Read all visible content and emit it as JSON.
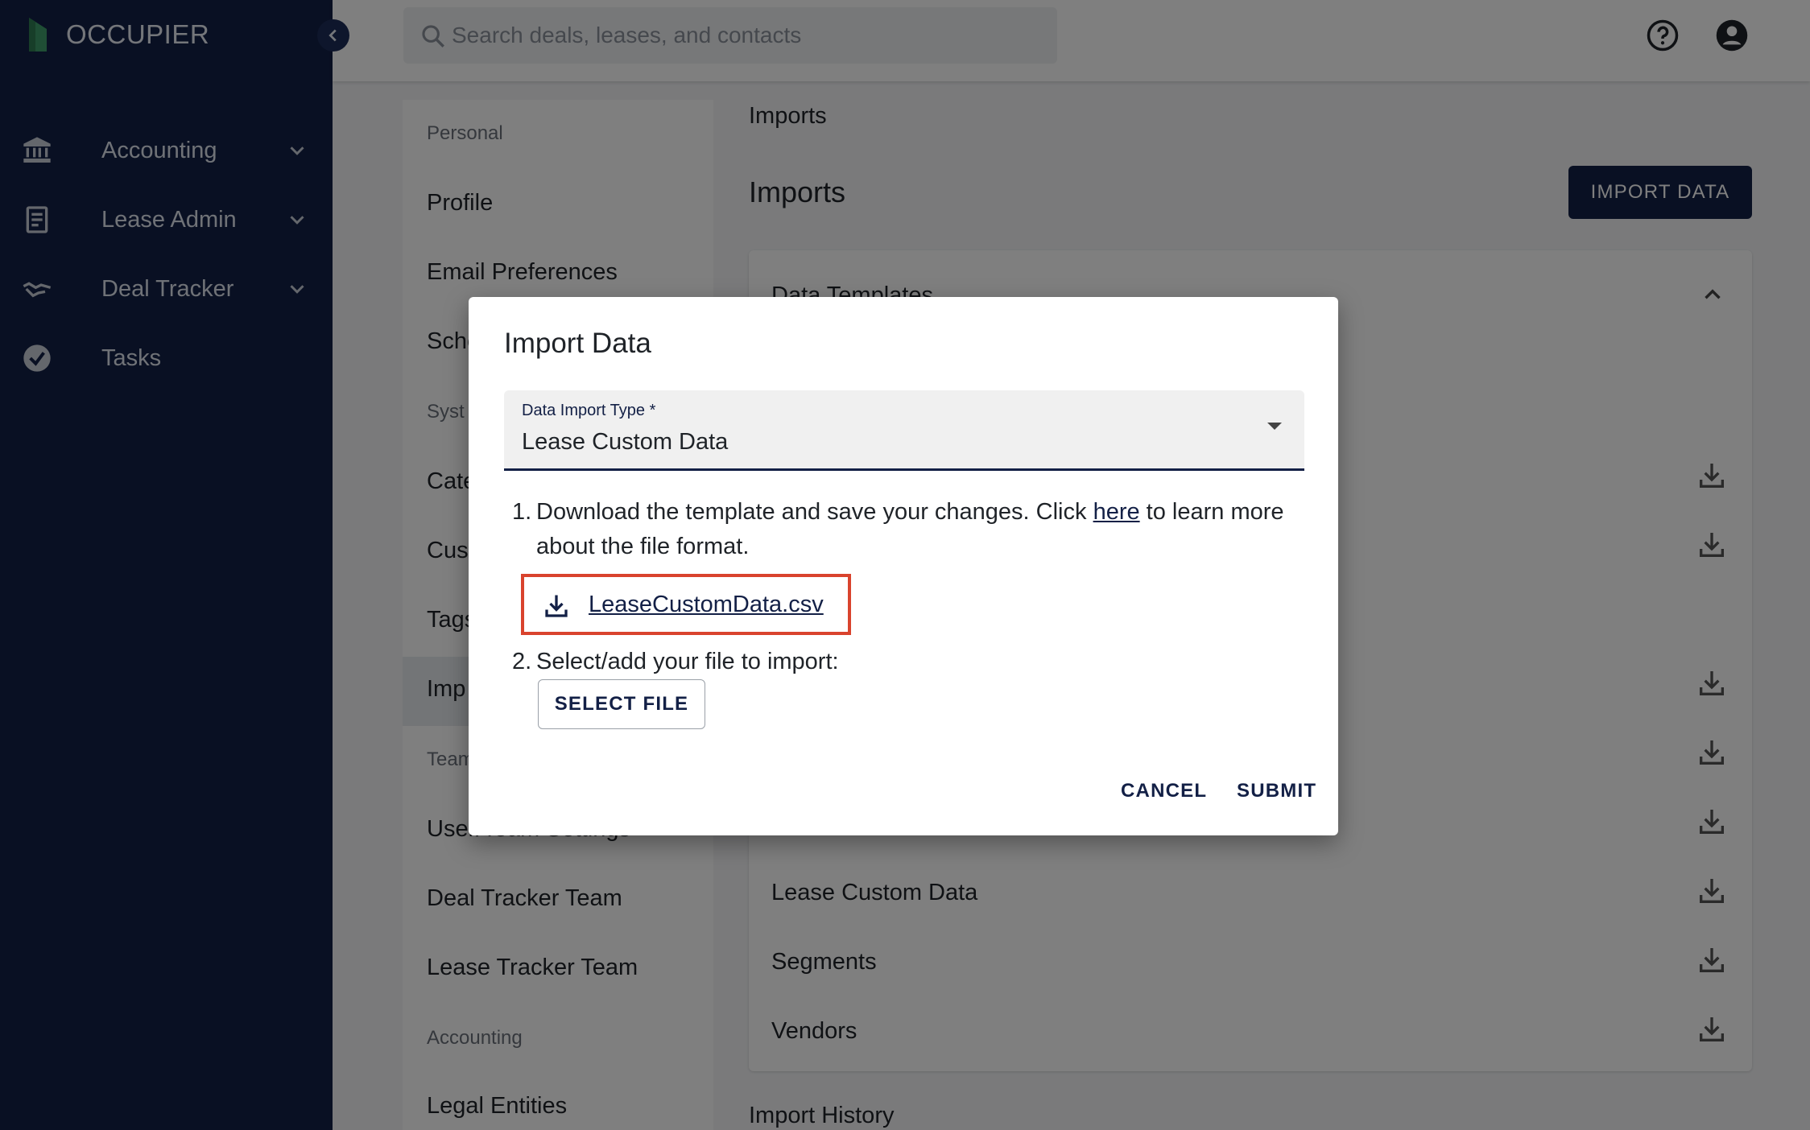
{
  "brand": {
    "name": "OCCUPIER",
    "accent": "#132046",
    "logo_green": "#3f9c6a"
  },
  "nav": {
    "items": [
      {
        "label": "Accounting",
        "icon": "bank-icon",
        "has_chevron": true
      },
      {
        "label": "Lease Admin",
        "icon": "document-icon",
        "has_chevron": true
      },
      {
        "label": "Deal Tracker",
        "icon": "handshake-icon",
        "has_chevron": true
      },
      {
        "label": "Tasks",
        "icon": "check-circle-icon",
        "has_chevron": false
      }
    ]
  },
  "topbar": {
    "search_placeholder": "Search deals, leases, and contacts",
    "icons": [
      "help-icon",
      "account-icon"
    ]
  },
  "settings": {
    "sections": {
      "personal": "Personal",
      "system": "Syst",
      "team": "Team",
      "accounting": "Accounting"
    },
    "items": {
      "profile": "Profile",
      "email": "Email Preferences",
      "sched": "Sche",
      "cate": "Cate",
      "cust": "Cust",
      "tags": "Tags",
      "imp": "Imp",
      "user_team": "User/Team Settings",
      "deal_team": "Deal Tracker Team",
      "lease_team": "Lease Tracker Team",
      "legal": "Legal Entities"
    }
  },
  "main": {
    "breadcrumb": "Imports",
    "title": "Imports",
    "import_button": "IMPORT DATA",
    "templates_title": "Data Templates",
    "templates": [
      "Lease Custom Data",
      "Segments",
      "Vendors"
    ],
    "history_title": "Import History"
  },
  "dialog": {
    "title": "Import Data",
    "field_label": "Data Import Type *",
    "field_value": "Lease Custom Data",
    "step1_prefix": "Download the template and save your changes. Click ",
    "step1_link": "here",
    "step1_suffix": " to learn more about the file format.",
    "step1_num": "1.",
    "file_name": "LeaseCustomData.csv",
    "step2_num": "2.",
    "step2_text": "Select/add your file to import:",
    "select_file": "SELECT FILE",
    "cancel": "CANCEL",
    "submit": "SUBMIT"
  }
}
